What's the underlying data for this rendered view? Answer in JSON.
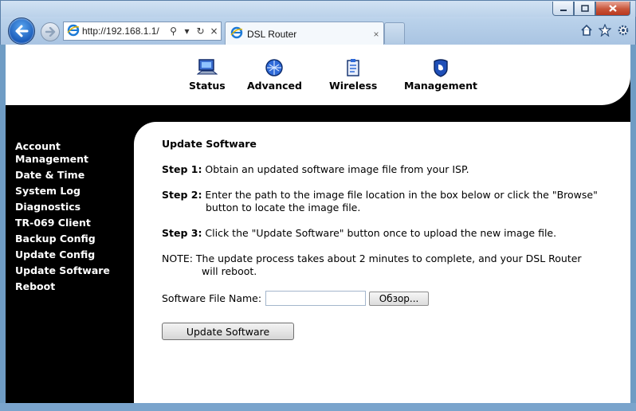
{
  "browser": {
    "url": "http://192.168.1.1/",
    "tab_title": "DSL Router",
    "tab_close": "×",
    "search_glyph": "⚲",
    "dropdown_glyph": "▾",
    "refresh_glyph": "↻",
    "stop_glyph": "×"
  },
  "topnav": {
    "status": "Status",
    "advanced": "Advanced",
    "wireless": "Wireless",
    "management": "Management"
  },
  "sidebar": {
    "items": [
      {
        "label": "Account Management"
      },
      {
        "label": "Date & Time"
      },
      {
        "label": "System Log"
      },
      {
        "label": "Diagnostics"
      },
      {
        "label": "TR-069 Client"
      },
      {
        "label": "Backup Config"
      },
      {
        "label": "Update Config"
      },
      {
        "label": "Update Software"
      },
      {
        "label": "Reboot"
      }
    ]
  },
  "content": {
    "title": "Update Software",
    "step1_label": "Step 1:",
    "step1_text": " Obtain an updated software image file from your ISP.",
    "step2_label": "Step 2:",
    "step2_text": " Enter the path to the image file location in the box below or click the \"Browse\"",
    "step2_cont": "button to locate the image file.",
    "step3_label": "Step 3:",
    "step3_text": " Click the \"Update Software\" button once to upload the new image file.",
    "note_text": "NOTE: The update process takes about 2 minutes to complete, and your DSL Router",
    "note_cont": "will reboot.",
    "file_label": "Software File Name:",
    "file_value": "",
    "browse_label": "Обзор...",
    "update_button": "Update Software"
  },
  "colors": {
    "sidebar_bg": "#000000",
    "sidebar_text": "#ffffff",
    "content_bg": "#ffffff",
    "chrome_blue": "#b9d1ea"
  }
}
